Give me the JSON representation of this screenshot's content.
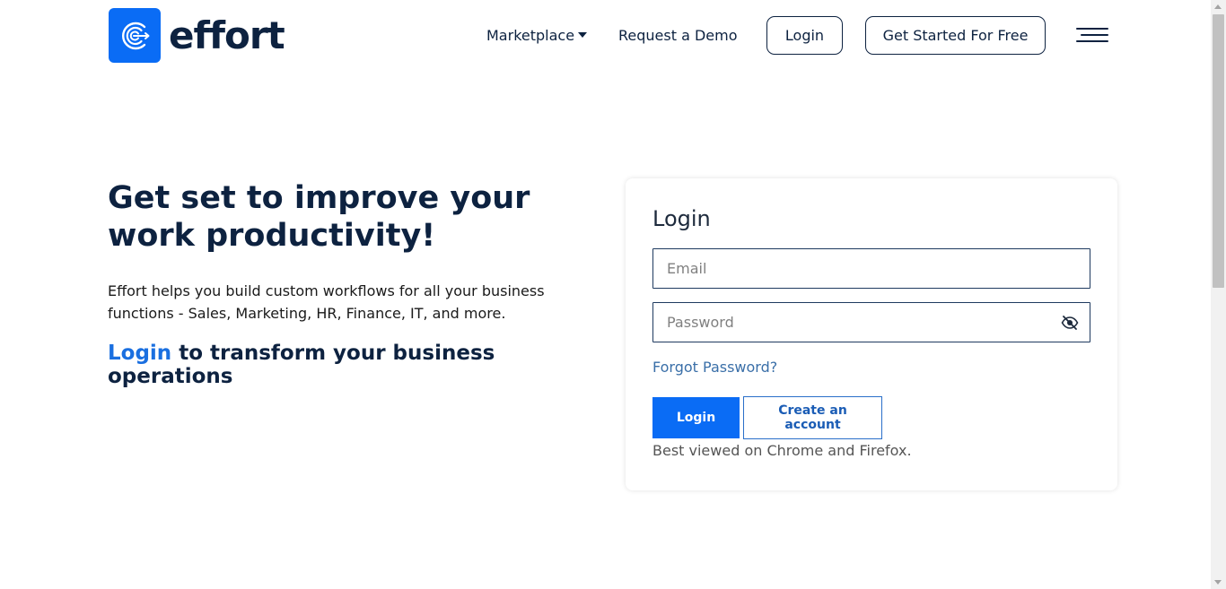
{
  "header": {
    "logo_text": "effort",
    "nav": {
      "marketplace": "Marketplace",
      "request_demo": "Request a Demo"
    },
    "login_button": "Login",
    "get_started_button": "Get Started For Free"
  },
  "hero": {
    "headline": "Get set to improve your work productivity!",
    "description": "Effort helps you build custom workflows for all your business functions - Sales, Marketing, HR, Finance, IT, and more.",
    "subhead_link": "Login",
    "subhead_rest": " to transform your business operations"
  },
  "login_card": {
    "title": "Login",
    "email_placeholder": "Email",
    "password_placeholder": "Password",
    "forgot_password": "Forgot Password?",
    "login_button": "Login",
    "create_account_button": "Create an account",
    "browser_note": "Best viewed on Chrome and Firefox."
  },
  "colors": {
    "brand_blue": "#0a6cf5",
    "navy": "#0d2240",
    "link_blue": "#1a6fe0"
  }
}
